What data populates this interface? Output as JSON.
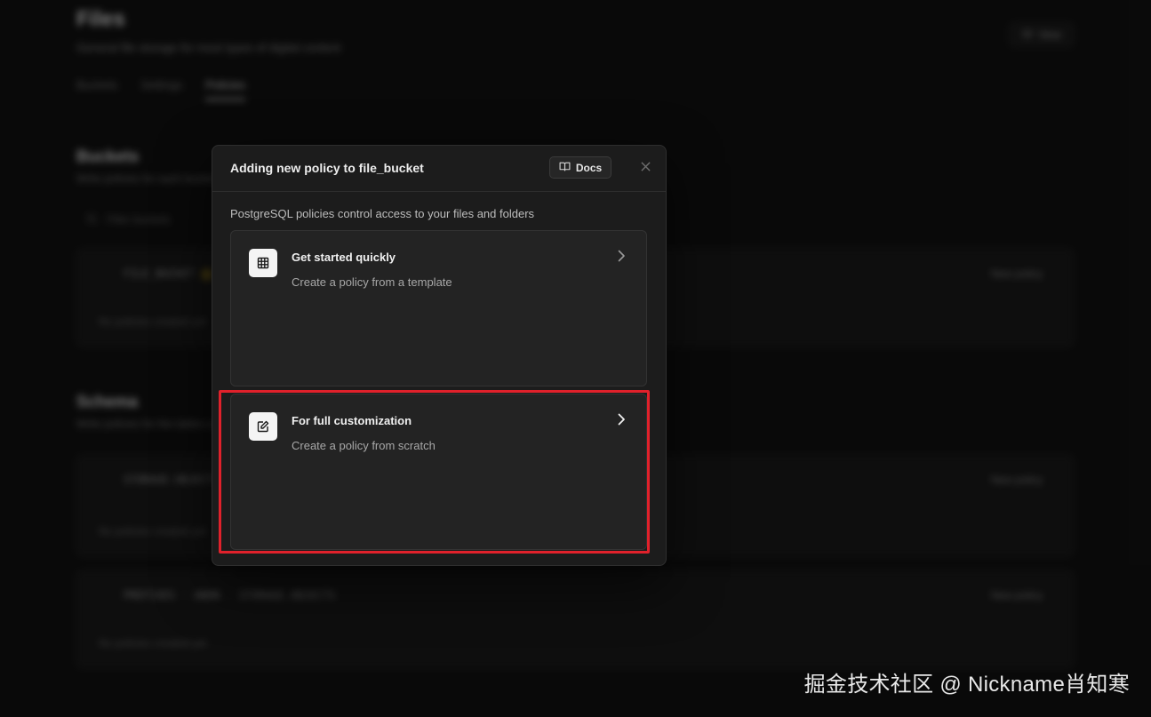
{
  "background": {
    "title": "Files",
    "subtitle": "General file storage for most types of digital content",
    "view_button": "View",
    "tabs": [
      {
        "label": "Buckets",
        "active": false
      },
      {
        "label": "Settings",
        "active": false
      },
      {
        "label": "Policies",
        "active": true
      }
    ],
    "buckets_section": {
      "title": "Buckets",
      "subtitle": "Write policies for each bucket to control access"
    },
    "search_placeholder": "Filter buckets",
    "bucket_card": {
      "name": "FILE_BUCKET",
      "action": "New policy",
      "empty_text": "No policies created yet"
    },
    "schema_section": {
      "title": "Schema",
      "subtitle": "Write policies for the tables under the storage schema directly"
    },
    "schema_cards": [
      {
        "name": "STORAGE.OBJECTS",
        "action": "New policy",
        "empty_text": "No policies created yet"
      },
      {
        "name": "PREFIXES · ANON · STORAGE.OBJECTS",
        "action": "New policy",
        "empty_text": "No policies created yet"
      }
    ]
  },
  "modal": {
    "title": "Adding new policy to file_bucket",
    "docs_label": "Docs",
    "description": "PostgreSQL policies control access to your files and folders",
    "options": [
      {
        "title": "Get started quickly",
        "subtitle": "Create a policy from a template",
        "icon": "table-grid-icon"
      },
      {
        "title": "For full customization",
        "subtitle": "Create a policy from scratch",
        "icon": "edit-icon"
      }
    ]
  },
  "highlight_color": "#e0212b",
  "watermark": "掘金技术社区 @ Nickname肖知寒"
}
